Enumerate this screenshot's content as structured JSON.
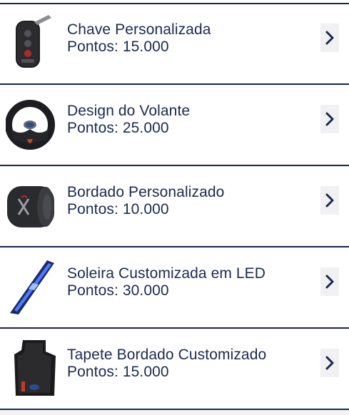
{
  "items": [
    {
      "title": "Chave Personalizada",
      "points": "Pontos: 15.000",
      "icon": "car-key-icon"
    },
    {
      "title": "Design do Volante",
      "points": "Pontos: 25.000",
      "icon": "steering-wheel-icon"
    },
    {
      "title": "Bordado Personalizado",
      "points": "Pontos: 10.000",
      "icon": "embroidered-headrest-icon"
    },
    {
      "title": "Soleira Customizada em LED",
      "points": "Pontos: 30.000",
      "icon": "led-sill-plate-icon"
    },
    {
      "title": "Tapete Bordado Customizado",
      "points": "Pontos: 15.000",
      "icon": "floor-mat-icon"
    }
  ],
  "colors": {
    "text": "#1b2a4e",
    "divider": "#1b2a4e",
    "chevron": "#1b2a4e",
    "chevron_bg": "#f1f1f3"
  }
}
